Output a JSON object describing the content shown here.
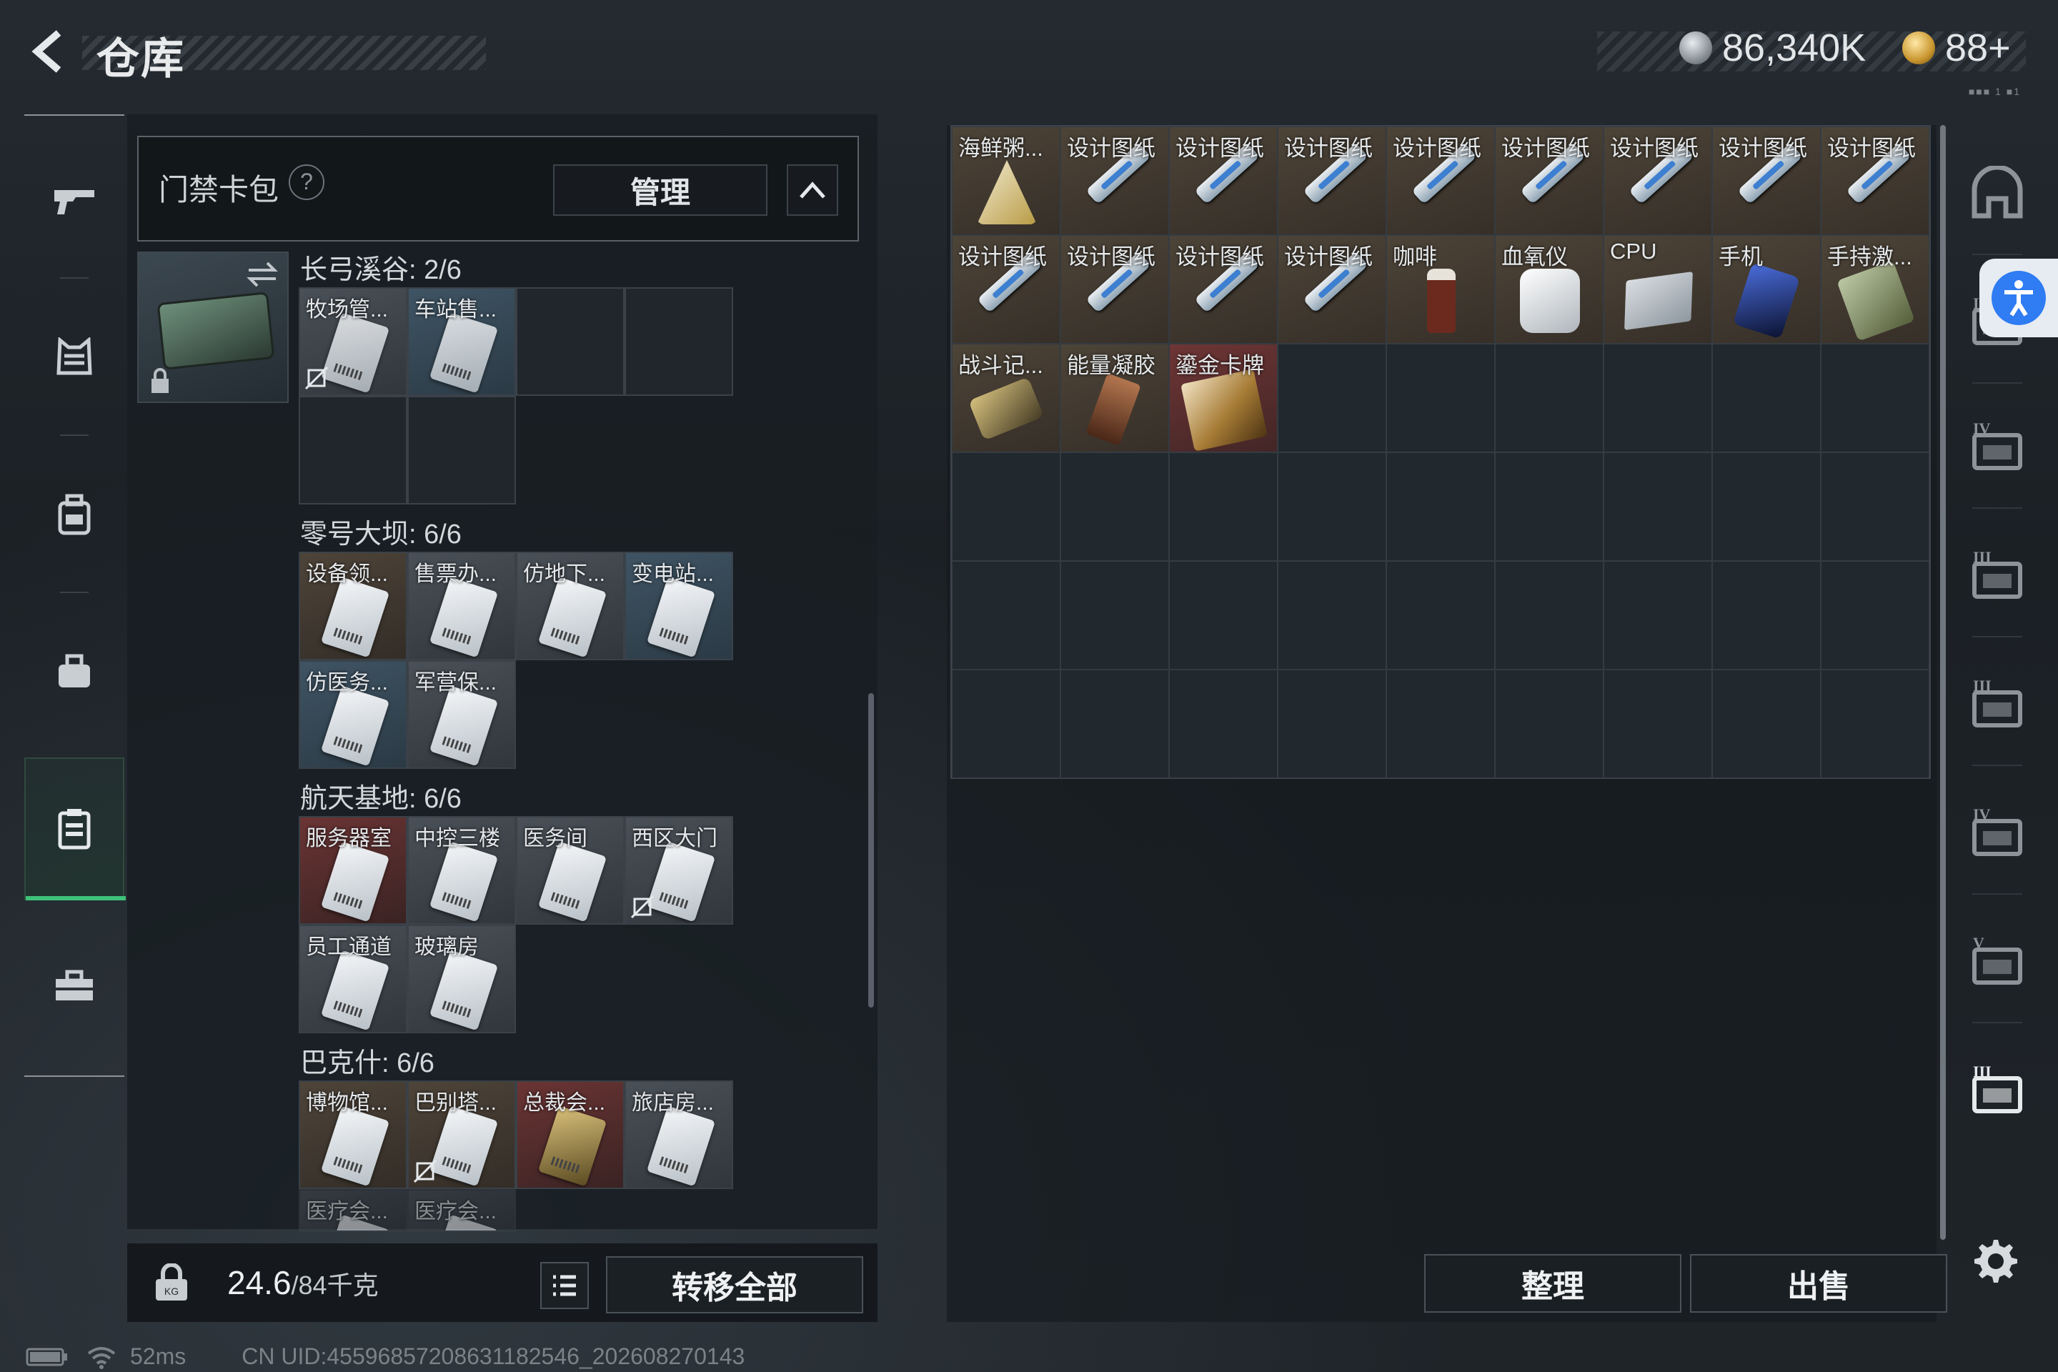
{
  "header": {
    "title": "仓库",
    "currency_silver": "86,340K",
    "currency_gold": "88+",
    "corner_text": "■■■ 1 ■1"
  },
  "nav": {
    "items": [
      {
        "name": "weapon",
        "icon": "gun-icon"
      },
      {
        "name": "armor",
        "icon": "armor-vest-icon"
      },
      {
        "name": "backpack",
        "icon": "backpack-icon"
      },
      {
        "name": "bag",
        "icon": "bag-icon"
      },
      {
        "name": "cardpack",
        "icon": "cardpack-icon",
        "active": true
      },
      {
        "name": "toolbox",
        "icon": "toolbox-icon"
      }
    ]
  },
  "card_panel": {
    "label": "门禁卡包",
    "help": "?",
    "manage_label": "管理",
    "groups": [
      {
        "title": "长弓溪谷: 2/6",
        "cards": [
          "牧场管...",
          "车站售...",
          "",
          "",
          "",
          ""
        ]
      },
      {
        "title": "零号大坝: 6/6",
        "cards": [
          "设备领...",
          "售票办...",
          "仿地下...",
          "变电站...",
          "仿医务...",
          "军营保..."
        ]
      },
      {
        "title": "航天基地: 6/6",
        "cards": [
          "服务器室",
          "中控三楼",
          "医务间",
          "西区大门",
          "员工通道",
          "玻璃房"
        ]
      },
      {
        "title": "巴克什: 6/6",
        "cards": [
          "博物馆...",
          "巴别塔...",
          "总裁会...",
          "旅店房...",
          "医疗会...",
          "医疗会..."
        ]
      }
    ]
  },
  "bottom_left": {
    "weight_value": "24.6",
    "weight_total": "/84千克",
    "transfer_label": "转移全部"
  },
  "status_bar": {
    "ping": "52ms",
    "uid": "CN UID:4559685720863118254​6_202608270143"
  },
  "storage": {
    "items": [
      {
        "label": "海鲜粥...",
        "kind": "food",
        "color": "brown"
      },
      {
        "label": "设计图纸",
        "kind": "blueprint",
        "color": "brown"
      },
      {
        "label": "设计图纸",
        "kind": "blueprint",
        "color": "brown"
      },
      {
        "label": "设计图纸",
        "kind": "blueprint",
        "color": "brown"
      },
      {
        "label": "设计图纸",
        "kind": "blueprint",
        "color": "brown"
      },
      {
        "label": "设计图纸",
        "kind": "blueprint",
        "color": "brown"
      },
      {
        "label": "设计图纸",
        "kind": "blueprint",
        "color": "brown"
      },
      {
        "label": "设计图纸",
        "kind": "blueprint",
        "color": "brown"
      },
      {
        "label": "设计图纸",
        "kind": "blueprint",
        "color": "brown"
      },
      {
        "label": "设计图纸",
        "kind": "blueprint",
        "color": "brown"
      },
      {
        "label": "设计图纸",
        "kind": "blueprint",
        "color": "brown"
      },
      {
        "label": "设计图纸",
        "kind": "blueprint",
        "color": "brown"
      },
      {
        "label": "设计图纸",
        "kind": "blueprint",
        "color": "brown"
      },
      {
        "label": "咖啡",
        "kind": "coffee",
        "color": "brown"
      },
      {
        "label": "血氧仪",
        "kind": "oximeter",
        "color": "brown"
      },
      {
        "label": "CPU",
        "kind": "cpu",
        "color": "brown"
      },
      {
        "label": "手机",
        "kind": "phone",
        "color": "brown"
      },
      {
        "label": "手持激...",
        "kind": "laser",
        "color": "brown"
      },
      {
        "label": "战斗记...",
        "kind": "recorder",
        "color": "brown"
      },
      {
        "label": "能量凝胶",
        "kind": "gel",
        "color": "brown"
      },
      {
        "label": "鎏金卡牌",
        "kind": "goldcard",
        "color": "red"
      }
    ],
    "sort_label": "整理",
    "sell_label": "出售"
  },
  "side_tabs": [
    {
      "name": "helmet",
      "icon": "helmet-icon"
    },
    {
      "name": "case-iv",
      "icon": "case-iv-icon"
    },
    {
      "name": "medkit-iv",
      "icon": "medkit-iv-icon"
    },
    {
      "name": "ammo-iii-a",
      "icon": "ammo-box-iii-icon"
    },
    {
      "name": "ammo-iii-b",
      "icon": "ammo-box-iii-icon"
    },
    {
      "name": "gun-iv",
      "icon": "gun-case-iv-icon"
    },
    {
      "name": "gear-v",
      "icon": "equip-v-icon"
    },
    {
      "name": "tools-iii",
      "icon": "tools-iii-icon"
    }
  ],
  "colors": {
    "accent_green": "#3ec27a",
    "accessibility_blue": "#2f7cf3",
    "slot_brown": "#4d4438",
    "slot_red": "#6e3535"
  }
}
